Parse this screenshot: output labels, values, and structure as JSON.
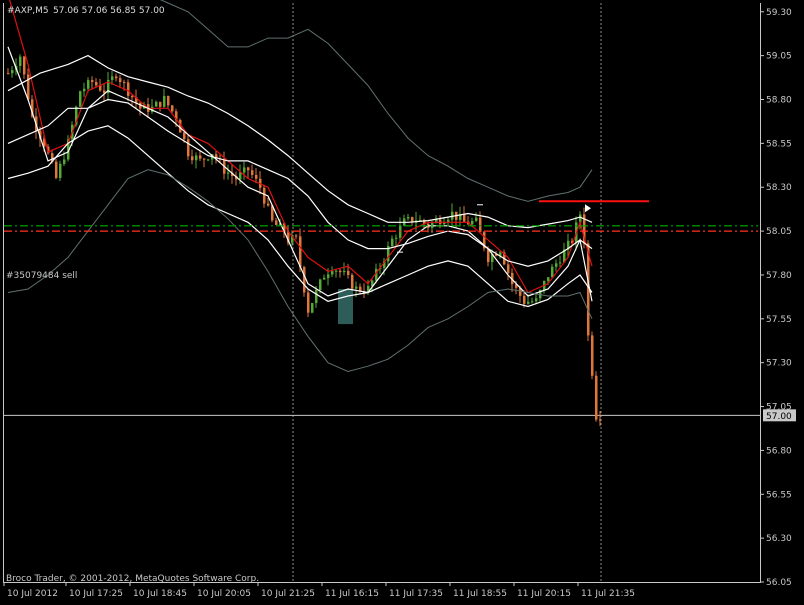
{
  "header": {
    "symbol": "#AXP,M5",
    "ohlc": "57.06 57.06 56.85 57.00"
  },
  "order_label": "#35079484 sell",
  "current_price_label": "57.00",
  "copyright": "Broco Trader, © 2001-2012, MetaQuotes Software Corp.",
  "colors": {
    "background": "#000000",
    "axis": "#c8c8c8",
    "bull": "#55aa33",
    "bear": "#e0763a",
    "ma_red": "#dd1111",
    "ma_white": "#ffffff",
    "ma_gray": "#607070",
    "order_line": "#00aa00",
    "sl_line": "#ff3322",
    "red_level": "#ff1111",
    "marker": "#2e5c58"
  },
  "chart_data": {
    "type": "candlestick",
    "grid": false,
    "ylim": [
      56.05,
      59.35
    ],
    "y_ticks": [
      "59.30",
      "59.05",
      "58.80",
      "58.55",
      "58.30",
      "58.05",
      "57.80",
      "57.55",
      "57.30",
      "57.05",
      "56.80",
      "56.55",
      "56.30",
      "56.05"
    ],
    "y_tick_values": [
      59.3,
      59.05,
      58.8,
      58.55,
      58.3,
      58.05,
      57.8,
      57.55,
      57.3,
      57.05,
      56.8,
      56.55,
      56.3,
      56.05
    ],
    "x_ticks": [
      "10 Jul 2012",
      "10 Jul 17:25",
      "10 Jul 18:45",
      "10 Jul 20:05",
      "10 Jul 21:25",
      "11 Jul 16:15",
      "11 Jul 17:35",
      "11 Jul 18:55",
      "11 Jul 20:15",
      "11 Jul 21:35"
    ],
    "bar_count": 149,
    "session_breaks_after_bar": [
      71,
      148
    ],
    "current_price": 57.0,
    "order_price": 58.08,
    "stop_price": 58.05,
    "red_level": 58.22,
    "red_level_from_bar": 133,
    "candle_path": [
      [
        0,
        58.95
      ],
      [
        3,
        59.05
      ],
      [
        6,
        58.7
      ],
      [
        9,
        58.55
      ],
      [
        12,
        58.35
      ],
      [
        15,
        58.55
      ],
      [
        18,
        58.85
      ],
      [
        21,
        58.9
      ],
      [
        24,
        58.85
      ],
      [
        27,
        58.95
      ],
      [
        30,
        58.85
      ],
      [
        33,
        58.75
      ],
      [
        36,
        58.75
      ],
      [
        39,
        58.8
      ],
      [
        42,
        58.7
      ],
      [
        45,
        58.5
      ],
      [
        48,
        58.45
      ],
      [
        51,
        58.5
      ],
      [
        54,
        58.4
      ],
      [
        57,
        58.35
      ],
      [
        60,
        58.4
      ],
      [
        63,
        58.3
      ],
      [
        66,
        58.1
      ],
      [
        69,
        58.05
      ],
      [
        70,
        58.0
      ],
      [
        72,
        58.0
      ],
      [
        73,
        57.85
      ],
      [
        75,
        57.6
      ],
      [
        77,
        57.7
      ],
      [
        79,
        57.8
      ],
      [
        81,
        57.85
      ],
      [
        84,
        57.8
      ],
      [
        87,
        57.72
      ],
      [
        90,
        57.72
      ],
      [
        93,
        57.85
      ],
      [
        96,
        58.0
      ],
      [
        99,
        58.1
      ],
      [
        102,
        58.12
      ],
      [
        105,
        58.08
      ],
      [
        108,
        58.12
      ],
      [
        111,
        58.15
      ],
      [
        114,
        58.1
      ],
      [
        117,
        58.1
      ],
      [
        120,
        57.9
      ],
      [
        123,
        57.95
      ],
      [
        126,
        57.75
      ],
      [
        129,
        57.65
      ],
      [
        132,
        57.65
      ],
      [
        135,
        57.8
      ],
      [
        138,
        57.9
      ],
      [
        141,
        58.0
      ],
      [
        143,
        58.15
      ],
      [
        144,
        58.0
      ],
      [
        145,
        57.45
      ],
      [
        146,
        57.25
      ],
      [
        147,
        57.0
      ],
      [
        148,
        57.0
      ]
    ],
    "series": [
      {
        "name": "",
        "color_key": "ma_red",
        "points": [
          [
            0,
            59.4
          ],
          [
            5,
            59.0
          ],
          [
            10,
            58.5
          ],
          [
            15,
            58.55
          ],
          [
            20,
            58.85
          ],
          [
            25,
            58.9
          ],
          [
            30,
            58.85
          ],
          [
            35,
            58.75
          ],
          [
            40,
            58.75
          ],
          [
            45,
            58.6
          ],
          [
            50,
            58.55
          ],
          [
            55,
            58.45
          ],
          [
            60,
            58.35
          ],
          [
            65,
            58.3
          ],
          [
            70,
            58.05
          ],
          [
            75,
            57.9
          ],
          [
            80,
            57.82
          ],
          [
            85,
            57.85
          ],
          [
            90,
            57.75
          ],
          [
            95,
            57.9
          ],
          [
            100,
            58.05
          ],
          [
            105,
            58.1
          ],
          [
            110,
            58.1
          ],
          [
            115,
            58.1
          ],
          [
            120,
            58.0
          ],
          [
            125,
            57.9
          ],
          [
            130,
            57.7
          ],
          [
            135,
            57.75
          ],
          [
            140,
            57.9
          ],
          [
            143,
            58.1
          ],
          [
            146,
            57.85
          ]
        ]
      },
      {
        "name": "",
        "color_key": "ma_white",
        "points": [
          [
            0,
            59.1
          ],
          [
            5,
            58.8
          ],
          [
            10,
            58.45
          ],
          [
            15,
            58.5
          ],
          [
            20,
            58.75
          ],
          [
            25,
            58.85
          ],
          [
            30,
            58.8
          ],
          [
            35,
            58.75
          ],
          [
            40,
            58.7
          ],
          [
            45,
            58.6
          ],
          [
            50,
            58.5
          ],
          [
            55,
            58.4
          ],
          [
            60,
            58.3
          ],
          [
            65,
            58.25
          ],
          [
            70,
            58.0
          ],
          [
            75,
            57.75
          ],
          [
            80,
            57.68
          ],
          [
            85,
            57.72
          ],
          [
            90,
            57.7
          ],
          [
            95,
            57.85
          ],
          [
            100,
            58.0
          ],
          [
            105,
            58.08
          ],
          [
            110,
            58.08
          ],
          [
            115,
            58.05
          ],
          [
            120,
            57.95
          ],
          [
            125,
            57.8
          ],
          [
            130,
            57.68
          ],
          [
            135,
            57.72
          ],
          [
            140,
            57.85
          ],
          [
            143,
            58.0
          ],
          [
            146,
            57.65
          ]
        ]
      },
      {
        "name": "",
        "color_key": "ma_white",
        "points": [
          [
            0,
            58.85
          ],
          [
            8,
            58.95
          ],
          [
            15,
            59.0
          ],
          [
            20,
            59.05
          ],
          [
            25,
            58.98
          ],
          [
            30,
            58.93
          ],
          [
            35,
            58.9
          ],
          [
            40,
            58.87
          ],
          [
            45,
            58.82
          ],
          [
            50,
            58.78
          ],
          [
            55,
            58.72
          ],
          [
            60,
            58.65
          ],
          [
            65,
            58.57
          ],
          [
            70,
            58.48
          ],
          [
            75,
            58.38
          ],
          [
            80,
            58.28
          ],
          [
            85,
            58.2
          ],
          [
            90,
            58.15
          ],
          [
            95,
            58.1
          ],
          [
            100,
            58.1
          ],
          [
            105,
            58.11
          ],
          [
            110,
            58.13
          ],
          [
            115,
            58.15
          ],
          [
            120,
            58.13
          ],
          [
            125,
            58.08
          ],
          [
            130,
            58.07
          ],
          [
            135,
            58.09
          ],
          [
            140,
            58.11
          ],
          [
            143,
            58.13
          ],
          [
            146,
            58.1
          ]
        ]
      },
      {
        "name": "",
        "color_key": "ma_white",
        "points": [
          [
            0,
            58.55
          ],
          [
            5,
            58.6
          ],
          [
            10,
            58.65
          ],
          [
            15,
            58.75
          ],
          [
            20,
            58.75
          ],
          [
            25,
            58.8
          ],
          [
            30,
            58.78
          ],
          [
            35,
            58.7
          ],
          [
            40,
            58.62
          ],
          [
            45,
            58.55
          ],
          [
            50,
            58.48
          ],
          [
            55,
            58.45
          ],
          [
            60,
            58.45
          ],
          [
            65,
            58.4
          ],
          [
            70,
            58.35
          ],
          [
            75,
            58.25
          ],
          [
            80,
            58.1
          ],
          [
            85,
            58.0
          ],
          [
            90,
            57.95
          ],
          [
            95,
            57.95
          ],
          [
            100,
            57.98
          ],
          [
            105,
            58.02
          ],
          [
            110,
            58.05
          ],
          [
            115,
            58.03
          ],
          [
            120,
            57.95
          ],
          [
            125,
            57.88
          ],
          [
            130,
            57.85
          ],
          [
            135,
            57.88
          ],
          [
            140,
            57.95
          ],
          [
            143,
            58.0
          ],
          [
            146,
            57.95
          ]
        ]
      },
      {
        "name": "",
        "color_key": "ma_white",
        "points": [
          [
            0,
            58.35
          ],
          [
            5,
            58.38
          ],
          [
            10,
            58.42
          ],
          [
            15,
            58.55
          ],
          [
            20,
            58.62
          ],
          [
            25,
            58.65
          ],
          [
            30,
            58.58
          ],
          [
            35,
            58.48
          ],
          [
            40,
            58.38
          ],
          [
            45,
            58.28
          ],
          [
            50,
            58.2
          ],
          [
            55,
            58.15
          ],
          [
            60,
            58.1
          ],
          [
            65,
            58.0
          ],
          [
            70,
            57.85
          ],
          [
            75,
            57.72
          ],
          [
            80,
            57.65
          ],
          [
            85,
            57.68
          ],
          [
            90,
            57.7
          ],
          [
            95,
            57.75
          ],
          [
            100,
            57.8
          ],
          [
            105,
            57.85
          ],
          [
            110,
            57.88
          ],
          [
            115,
            57.85
          ],
          [
            120,
            57.75
          ],
          [
            125,
            57.65
          ],
          [
            130,
            57.62
          ],
          [
            135,
            57.66
          ],
          [
            140,
            57.75
          ],
          [
            143,
            57.8
          ],
          [
            146,
            57.7
          ]
        ]
      },
      {
        "name": "",
        "color_key": "ma_gray",
        "points": [
          [
            0,
            59.4
          ],
          [
            8,
            59.4
          ],
          [
            15,
            59.45
          ],
          [
            20,
            59.5
          ],
          [
            25,
            59.5
          ],
          [
            30,
            59.42
          ],
          [
            35,
            59.4
          ],
          [
            40,
            59.35
          ],
          [
            45,
            59.3
          ],
          [
            50,
            59.2
          ],
          [
            55,
            59.1
          ],
          [
            60,
            59.1
          ],
          [
            65,
            59.15
          ],
          [
            70,
            59.15
          ],
          [
            75,
            59.2
          ],
          [
            80,
            59.12
          ],
          [
            85,
            59.0
          ],
          [
            90,
            58.88
          ],
          [
            95,
            58.72
          ],
          [
            100,
            58.58
          ],
          [
            105,
            58.48
          ],
          [
            110,
            58.42
          ],
          [
            115,
            58.35
          ],
          [
            120,
            58.3
          ],
          [
            125,
            58.25
          ],
          [
            130,
            58.22
          ],
          [
            135,
            58.25
          ],
          [
            140,
            58.27
          ],
          [
            143,
            58.3
          ],
          [
            146,
            58.4
          ]
        ]
      },
      {
        "name": "",
        "color_key": "ma_gray",
        "points": [
          [
            0,
            57.7
          ],
          [
            5,
            57.72
          ],
          [
            10,
            57.8
          ],
          [
            15,
            57.9
          ],
          [
            20,
            58.05
          ],
          [
            25,
            58.2
          ],
          [
            30,
            58.35
          ],
          [
            35,
            58.4
          ],
          [
            40,
            58.37
          ],
          [
            45,
            58.3
          ],
          [
            50,
            58.22
          ],
          [
            55,
            58.12
          ],
          [
            60,
            58.0
          ],
          [
            65,
            57.82
          ],
          [
            70,
            57.62
          ],
          [
            75,
            57.45
          ],
          [
            80,
            57.3
          ],
          [
            85,
            57.25
          ],
          [
            90,
            57.28
          ],
          [
            95,
            57.32
          ],
          [
            100,
            57.4
          ],
          [
            105,
            57.5
          ],
          [
            110,
            57.55
          ],
          [
            115,
            57.62
          ],
          [
            120,
            57.7
          ],
          [
            125,
            57.72
          ],
          [
            130,
            57.7
          ],
          [
            135,
            57.68
          ],
          [
            140,
            57.68
          ],
          [
            143,
            57.7
          ],
          [
            146,
            57.55
          ]
        ]
      }
    ],
    "ticks_marks": [
      {
        "bar": 98,
        "price": 57.93
      },
      {
        "bar": 118,
        "price": 58.2
      }
    ],
    "marker_box": {
      "from_bar": 83,
      "to_bar": 86,
      "top": 57.72,
      "bottom": 57.52
    }
  }
}
